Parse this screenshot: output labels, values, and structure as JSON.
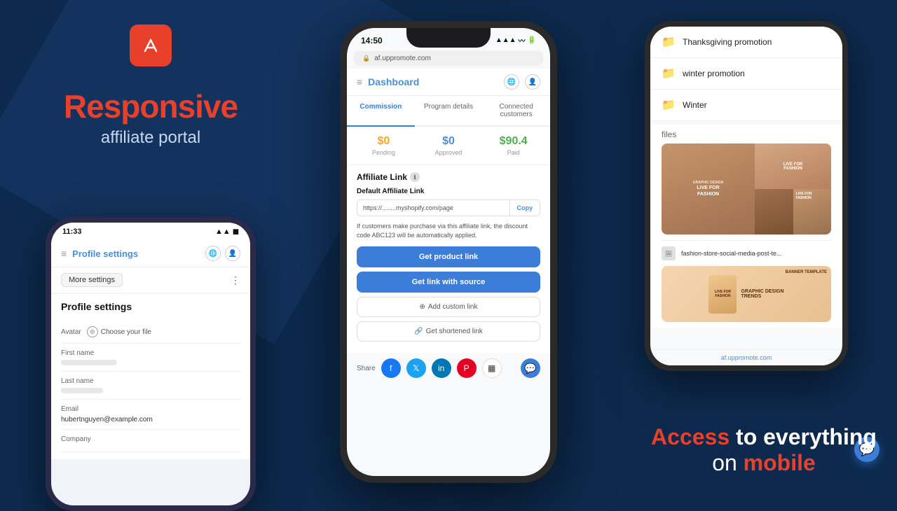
{
  "app": {
    "logo_symbol": "⬆",
    "tagline_main": "Responsive",
    "tagline_sub": "affiliate portal"
  },
  "left_phone": {
    "time": "11:33",
    "nav_title": "Profile settings",
    "more_settings": "More settings",
    "profile_title": "Profile settings",
    "avatar_label": "Avatar",
    "avatar_choose": "Choose your file",
    "firstname_label": "First name",
    "lastname_label": "Last name",
    "email_label": "Email",
    "email_value": "hubertnguyen@example.com",
    "company_label": "Company"
  },
  "center_phone": {
    "time": "14:50",
    "url": "af.uppromote.com",
    "nav_title": "Dashboard",
    "tabs": [
      "Commission",
      "Program details",
      "Connected customers"
    ],
    "active_tab": "Commission",
    "stats": {
      "pending_value": "$0",
      "pending_label": "Pending",
      "approved_value": "$0",
      "approved_label": "Approved",
      "paid_value": "$90.4",
      "paid_label": "Paid"
    },
    "affiliate_link_title": "Affiliate Link",
    "default_link_label": "Default Affiliate Link",
    "link_url": "https://........myshopify.com/page",
    "copy_btn": "Copy",
    "notice_text": "If customers make purchase via this affiliate link, the discount code ABC123 will be automatically applied.",
    "btn_product_link": "Get product link",
    "btn_link_source": "Get link with source",
    "btn_add_custom": "Add custom link",
    "btn_shortened": "Get shortened link",
    "share_label": "Share"
  },
  "right_phone": {
    "folders": [
      {
        "name": "Thanksgiving promotion"
      },
      {
        "name": "winter promotion"
      },
      {
        "name": "Winter"
      }
    ],
    "files_label": "files",
    "file_name": "fashion-store-social-media-post-te...",
    "url_bar": "af.uppromote.com"
  },
  "access_text": {
    "line1_prefix": "Access",
    "line1_rest": " to everything",
    "line2_prefix": "on ",
    "line2_accent": "mobile"
  }
}
